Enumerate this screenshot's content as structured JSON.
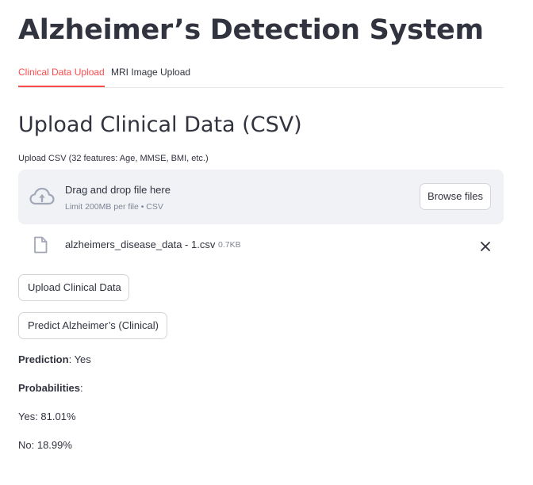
{
  "app": {
    "title": "Alzheimer’s Detection System"
  },
  "tabs": [
    {
      "label": "Clinical Data Upload",
      "active": true
    },
    {
      "label": "MRI Image Upload",
      "active": false
    }
  ],
  "section": {
    "heading": "Upload Clinical Data (CSV)"
  },
  "uploader": {
    "label": "Upload CSV (32 features: Age, MMSE, BMI, etc.)",
    "drop_text": "Drag and drop file here",
    "limit_text": "Limit 200MB per file • CSV",
    "browse_label": "Browse files",
    "icon": "cloud-upload-icon"
  },
  "uploaded_file": {
    "name": "alzheimers_disease_data - 1.csv",
    "size": "0.7KB",
    "icon": "file-icon",
    "remove_icon": "close-icon"
  },
  "actions": {
    "upload_label": "Upload Clinical Data",
    "predict_label": "Predict Alzheimer’s (Clinical)"
  },
  "results": {
    "prediction_label": "Prediction",
    "prediction_value": ": Yes",
    "probabilities_label": "Probabilities",
    "probabilities_suffix": ":",
    "yes_line": "Yes: 81.01%",
    "no_line": "No: 18.99%"
  },
  "colors": {
    "accent": "#ff4b4b",
    "text": "#31333f",
    "muted": "#808495",
    "dropzone_bg": "#f0f2f6",
    "icon": "#a3a8b8"
  }
}
